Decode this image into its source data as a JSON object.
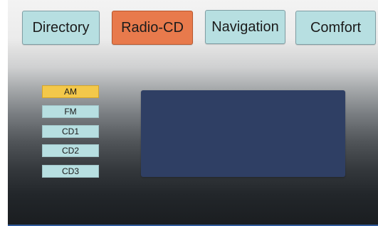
{
  "tabs": {
    "directory": "Directory",
    "radio_cd": "Radio-CD",
    "navigation": "Navigation",
    "comfort": "Comfort",
    "active": "radio_cd"
  },
  "sources": {
    "items": [
      {
        "label": "AM",
        "selected": true
      },
      {
        "label": "FM",
        "selected": false
      },
      {
        "label": "CD1",
        "selected": false
      },
      {
        "label": "CD2",
        "selected": false
      },
      {
        "label": "CD3",
        "selected": false
      }
    ]
  },
  "colors": {
    "tab_background": "#b7dfe1",
    "tab_active": "#e87a4c",
    "source_selected": "#f3c84a",
    "display_panel": "#2f3f64"
  }
}
